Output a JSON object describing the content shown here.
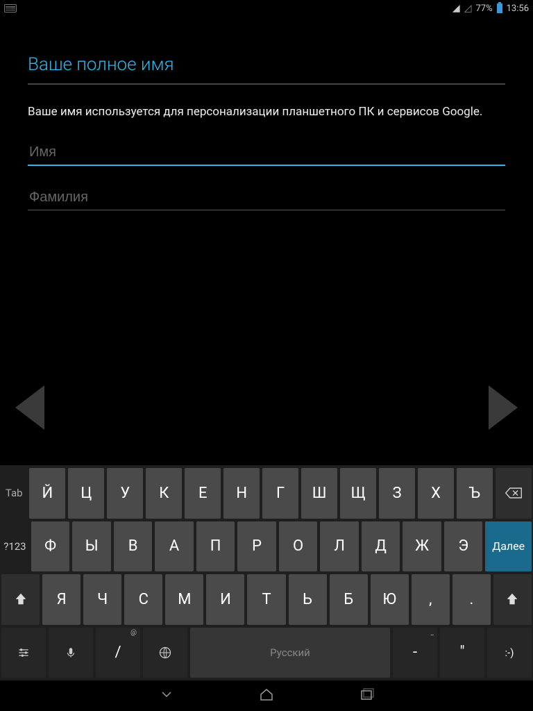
{
  "status": {
    "battery": "77%",
    "time": "13:56",
    "signal_glyph": "◿"
  },
  "page": {
    "title": "Ваше полное имя",
    "description": "Ваше имя используется для персонализации планшетного ПК и сервисов Google."
  },
  "fields": {
    "first_name": {
      "placeholder": "Имя",
      "value": ""
    },
    "last_name": {
      "placeholder": "Фамилия",
      "value": ""
    }
  },
  "keyboard": {
    "tab": "Tab",
    "sym": "?123",
    "enter": "Далее",
    "space": "Русский",
    "row1": [
      "Й",
      "Ц",
      "У",
      "К",
      "Е",
      "Н",
      "Г",
      "Ш",
      "Щ",
      "З",
      "Х",
      "Ъ"
    ],
    "row2": [
      "Ф",
      "Ы",
      "В",
      "А",
      "П",
      "Р",
      "О",
      "Л",
      "Д",
      "Ж",
      "Э"
    ],
    "row3": [
      "Я",
      "Ч",
      "С",
      "М",
      "И",
      "Т",
      "Ь",
      "Б",
      "Ю",
      ",",
      "."
    ],
    "row4": {
      "slash": "/",
      "slash_sup": "@",
      "dash": "-",
      "dash_sup": "_",
      "quote": "\"",
      "smile": ":-)"
    }
  }
}
